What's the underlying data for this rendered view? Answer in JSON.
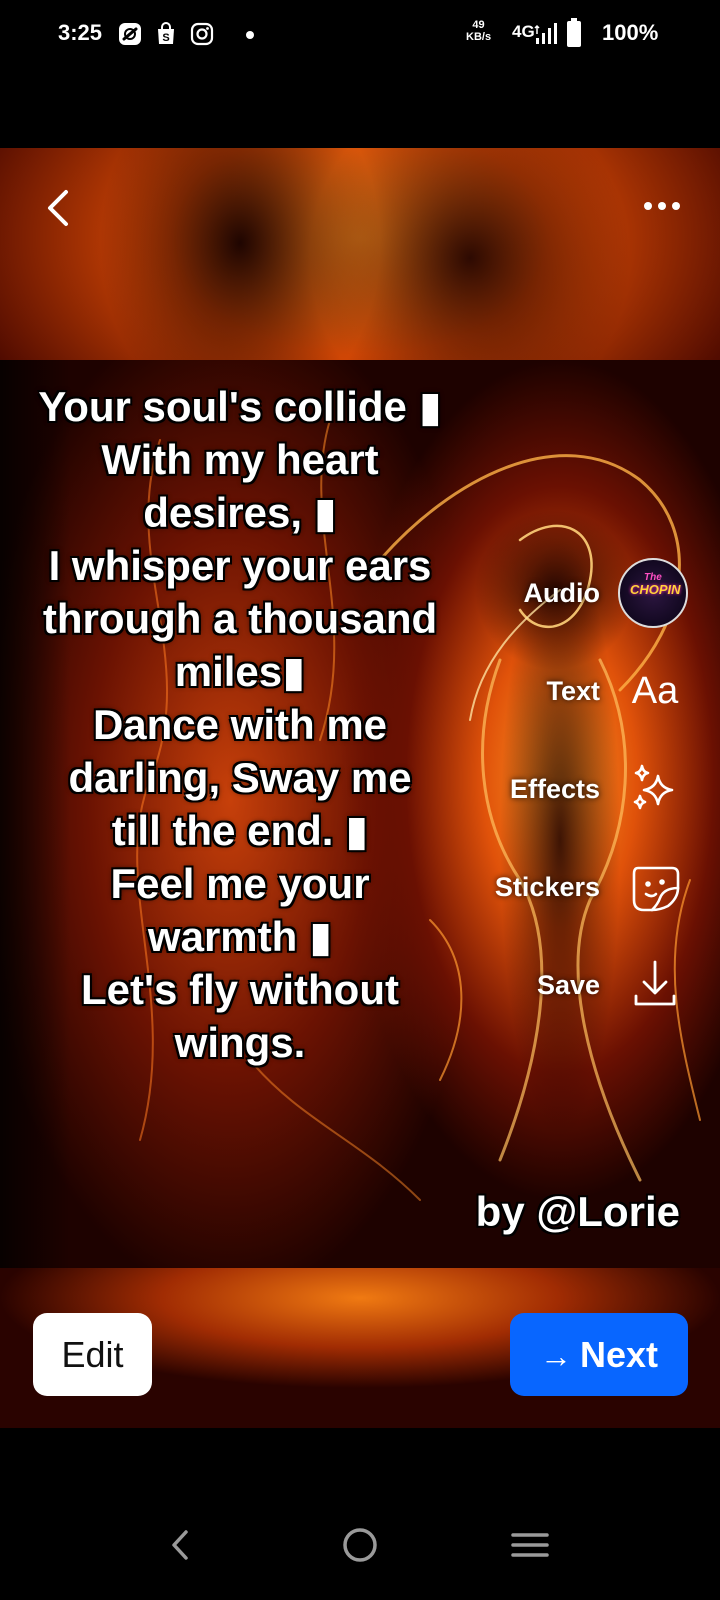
{
  "status_bar": {
    "time": "3:25",
    "icons": [
      "status-bar-app-icon",
      "shopping-bag-icon",
      "instagram-icon"
    ],
    "net_speed_value": "49",
    "net_speed_unit": "KB/s",
    "network": "4G",
    "battery": "100%"
  },
  "top_bar": {
    "back_icon": "chevron-left-icon",
    "more_icon": "more-horizontal-icon"
  },
  "poem": {
    "lines": [
      "Your soul's collide ▮",
      "With my heart",
      "desires, ▮",
      "I whisper your ears",
      "through a thousand",
      "miles▮",
      "Dance with me",
      "darling, Sway me",
      "till the end. ▮",
      "Feel me your",
      "warmth ▮",
      "Let's fly without",
      "wings."
    ]
  },
  "tools": {
    "audio": {
      "label": "Audio",
      "disc_top": "The",
      "disc_text": "CHOPIN"
    },
    "text": {
      "label": "Text",
      "icon_text": "Aa"
    },
    "effects": {
      "label": "Effects"
    },
    "stickers": {
      "label": "Stickers"
    },
    "save": {
      "label": "Save"
    }
  },
  "byline": "by @Lorie",
  "actions": {
    "edit_label": "Edit",
    "next_arrow": "→",
    "next_label": "Next"
  },
  "colors": {
    "next_button": "#0866ff",
    "edit_button": "#ffffff",
    "background": "#000000"
  }
}
